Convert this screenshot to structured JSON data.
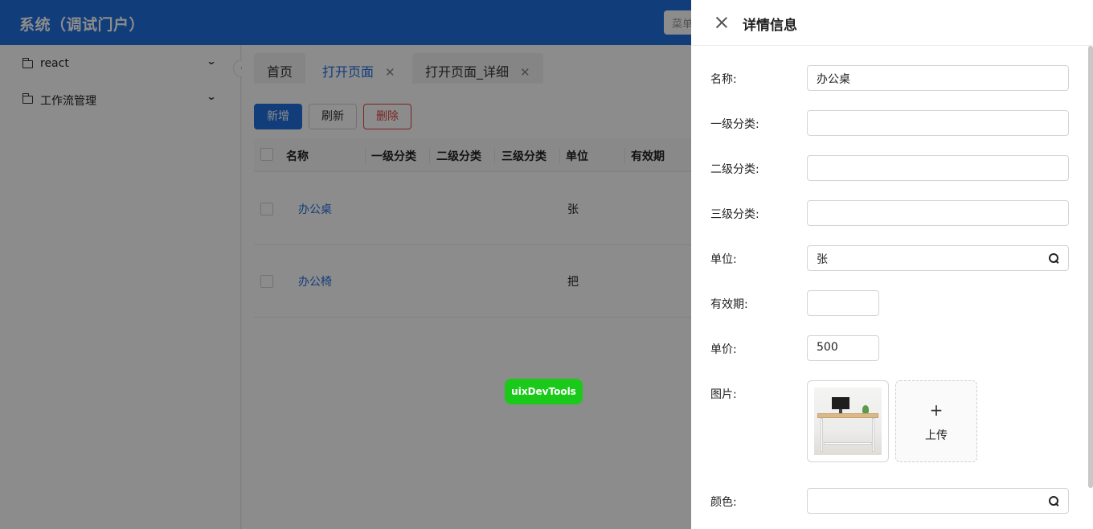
{
  "header": {
    "app_title": "系统（调试门户）",
    "search_placeholder": "菜单"
  },
  "sidebar": {
    "items": [
      {
        "label": "react",
        "icon": "folder-icon"
      },
      {
        "label": "工作流管理",
        "icon": "folder-icon"
      }
    ],
    "collapse_icon": "chevron-left-icon"
  },
  "tabs": [
    {
      "label": "首页",
      "closable": false,
      "active": false
    },
    {
      "label": "打开页面",
      "closable": true,
      "active": true
    },
    {
      "label": "打开页面_详细",
      "closable": true,
      "active": false
    }
  ],
  "toolbar": {
    "add_label": "新增",
    "refresh_label": "刷新",
    "delete_label": "删除"
  },
  "table": {
    "columns": [
      "名称",
      "一级分类",
      "二级分类",
      "三级分类",
      "单位",
      "有效期"
    ],
    "rows": [
      {
        "name": "办公桌",
        "unit": "张"
      },
      {
        "name": "办公椅",
        "unit": "把"
      }
    ]
  },
  "dev_tools_label": "uixDevTools",
  "drawer": {
    "title": "详情信息",
    "fields": {
      "name": {
        "label": "名称:",
        "value": "办公桌"
      },
      "cat1": {
        "label": "一级分类:",
        "value": ""
      },
      "cat2": {
        "label": "二级分类:",
        "value": ""
      },
      "cat3": {
        "label": "三级分类:",
        "value": ""
      },
      "unit": {
        "label": "单位:",
        "value": "张"
      },
      "validity": {
        "label": "有效期:",
        "value": ""
      },
      "price": {
        "label": "单价:",
        "value": "500"
      },
      "image": {
        "label": "图片:"
      },
      "color": {
        "label": "颜色:",
        "value": ""
      }
    },
    "upload": {
      "plus": "+",
      "label": "上传"
    }
  },
  "colors": {
    "primary": "#1f6fe0",
    "danger": "#e04343",
    "devtools": "#1bc91b"
  }
}
